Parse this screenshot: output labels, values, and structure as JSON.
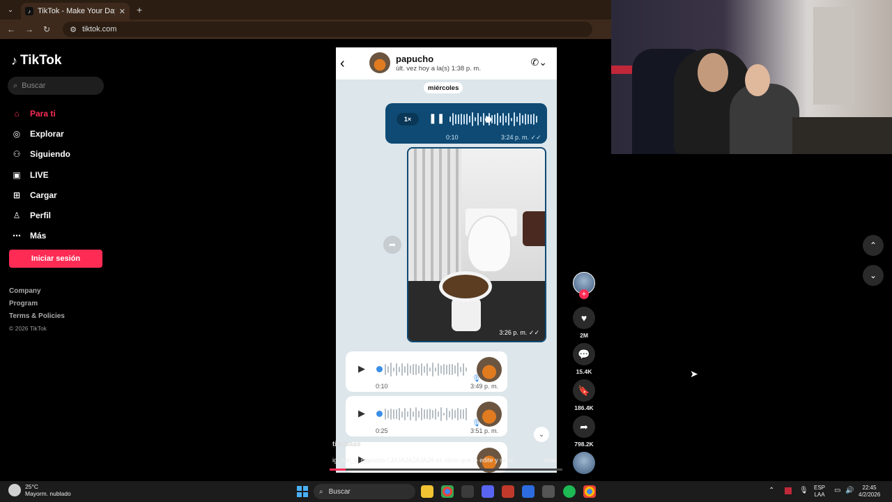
{
  "browser": {
    "tab_title": "TikTok - Make Your Day",
    "url": "tiktok.com"
  },
  "sidebar": {
    "logo": "TikTok",
    "search_placeholder": "Buscar",
    "items": [
      {
        "label": "Para ti",
        "icon": "home-icon",
        "active": true
      },
      {
        "label": "Explorar",
        "icon": "compass-icon"
      },
      {
        "label": "Siguiendo",
        "icon": "following-icon"
      },
      {
        "label": "LIVE",
        "icon": "live-icon"
      },
      {
        "label": "Cargar",
        "icon": "upload-icon"
      },
      {
        "label": "Perfil",
        "icon": "profile-icon"
      },
      {
        "label": "Más",
        "icon": "more-icon"
      }
    ],
    "login_label": "Iniciar sesión",
    "footer": [
      "Company",
      "Program",
      "Terms & Policies"
    ],
    "copyright": "© 2026 TikTok"
  },
  "chat": {
    "name": "papucho",
    "status": "últ. vez hoy a la(s) 1:38 p. m.",
    "date_label": "miércoles",
    "outgoing_audio": {
      "speed": "1×",
      "elapsed": "0:10",
      "time": "3:24 p. m.",
      "progress": 0.45
    },
    "photo_time": "3:26 p. m.",
    "incoming_audios": [
      {
        "duration": "0:10",
        "time": "3:49 p. m."
      },
      {
        "duration": "0:25",
        "time": "3:51 p. m."
      }
    ]
  },
  "video": {
    "username": "tiarisaas",
    "caption": "ig: tiari_y_papucho / JAJAJAJAJAJA es obvio que lo edite y se la",
    "more_label": "más",
    "progress": 0.07
  },
  "actions": {
    "likes": "2M",
    "comments": "15.4K",
    "saves": "186.4K",
    "shares": "798.2K"
  },
  "taskbar": {
    "temperature": "25°C",
    "weather": "Mayorm. nublado",
    "search": "Buscar",
    "lang_top": "ESP",
    "lang_bottom": "LAA",
    "time": "22:45",
    "date": "4/2/2026"
  },
  "colors": {
    "accent": "#fe2c55",
    "bubble_out": "#0e4a74"
  }
}
